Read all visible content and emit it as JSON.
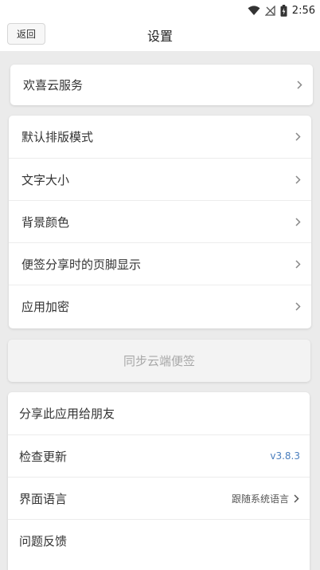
{
  "status_bar": {
    "time": "2:56",
    "icons": [
      "wifi-icon",
      "no-signal-icon",
      "battery-charging-icon"
    ]
  },
  "header": {
    "back_label": "返回",
    "title": "设置"
  },
  "card1": {
    "items": [
      {
        "label": "欢喜云服务",
        "icon": "chevron-right-icon"
      }
    ]
  },
  "card2": {
    "items": [
      {
        "label": "默认排版模式",
        "icon": "chevron-right-icon"
      },
      {
        "label": "文字大小",
        "icon": "chevron-right-icon"
      },
      {
        "label": "背景颜色",
        "icon": "chevron-right-icon"
      },
      {
        "label": "便签分享时的页脚显示",
        "icon": "chevron-right-icon"
      },
      {
        "label": "应用加密",
        "icon": "chevron-right-icon"
      }
    ]
  },
  "sync": {
    "label": "同步云端便签"
  },
  "card3": {
    "items": [
      {
        "label": "分享此应用给朋友"
      },
      {
        "label": "检查更新",
        "value": "v3.8.3"
      },
      {
        "label": "界面语言",
        "value": "跟随系统语言",
        "icon": "chevron-right-icon"
      },
      {
        "label": "问题反馈"
      }
    ]
  },
  "colors": {
    "accent": "#4a7ebd",
    "page_bg": "#ebebeb",
    "card_bg": "#ffffff",
    "disabled_text": "#a8a8a8"
  }
}
